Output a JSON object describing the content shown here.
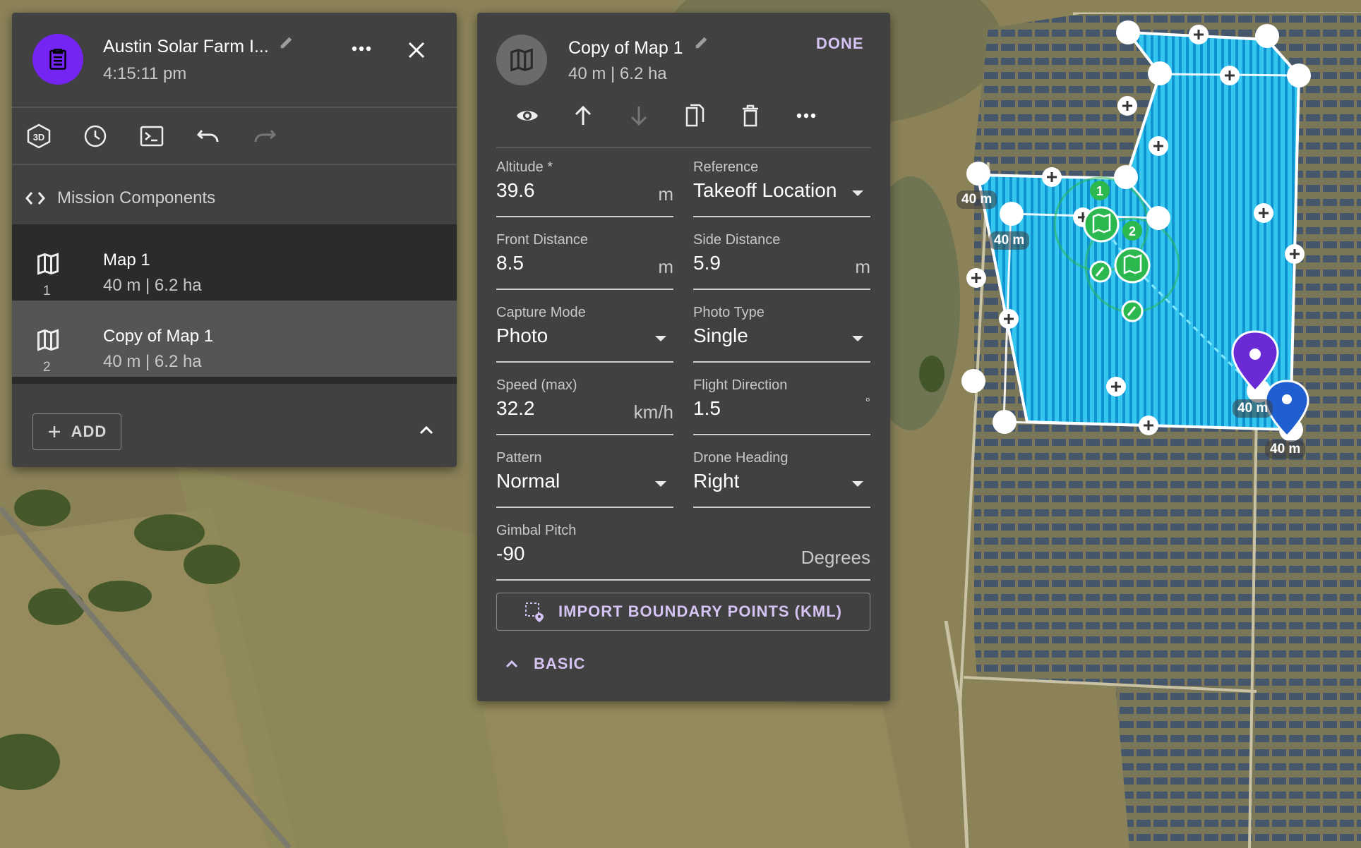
{
  "mission": {
    "title": "Austin Solar Farm I...",
    "time": "4:15:11 pm",
    "icons": [
      "clipboard-icon",
      "pencil-icon",
      "more-horizontal-icon",
      "close-icon"
    ]
  },
  "toolbar": {
    "icons": [
      "3d-icon",
      "clock-icon",
      "terminal-icon",
      "undo-icon",
      "redo-icon"
    ]
  },
  "components": {
    "label": "Mission Components",
    "items": [
      {
        "name": "Map 1",
        "details": "40 m | 6.2 ha",
        "index": "1"
      },
      {
        "name": "Copy of Map 1",
        "details": "40 m | 6.2 ha",
        "index": "2",
        "selected": true
      }
    ],
    "add_label": "ADD"
  },
  "editor": {
    "title": "Copy of Map 1",
    "details": "40 m | 6.2 ha",
    "done_label": "DONE",
    "action_icons": [
      "eye-icon",
      "arrow-up-icon",
      "arrow-down-icon",
      "copy-icon",
      "delete-icon",
      "more-horizontal-icon"
    ],
    "fields": {
      "altitude": {
        "label": "Altitude *",
        "value": "39.6",
        "unit": "m"
      },
      "reference": {
        "label": "Reference",
        "value": "Takeoff Location"
      },
      "front_distance": {
        "label": "Front Distance",
        "value": "8.5",
        "unit": "m"
      },
      "side_distance": {
        "label": "Side Distance",
        "value": "5.9",
        "unit": "m"
      },
      "capture_mode": {
        "label": "Capture Mode",
        "value": "Photo"
      },
      "photo_type": {
        "label": "Photo Type",
        "value": "Single"
      },
      "speed": {
        "label": "Speed (max)",
        "value": "32.2",
        "unit": "km/h"
      },
      "flight_direction": {
        "label": "Flight Direction",
        "value": "1.5",
        "unit": "°"
      },
      "pattern": {
        "label": "Pattern",
        "value": "Normal"
      },
      "drone_heading": {
        "label": "Drone Heading",
        "value": "Right"
      },
      "gimbal_pitch": {
        "label": "Gimbal Pitch",
        "value": "-90",
        "unit": "Degrees"
      }
    },
    "import_label": "IMPORT BOUNDARY POINTS (KML)",
    "basic_label": "BASIC"
  },
  "map": {
    "height_labels": [
      "40 m",
      "40 m",
      "40 m",
      "40 m"
    ],
    "marker_numbers": [
      "1",
      "2"
    ],
    "colors": {
      "polygon": "#2fc3ef",
      "stripe": "#0d98d6",
      "marker": "#2bb84f",
      "pin_purple": "#6a2bd6",
      "pin_blue": "#1f5fd0"
    }
  }
}
